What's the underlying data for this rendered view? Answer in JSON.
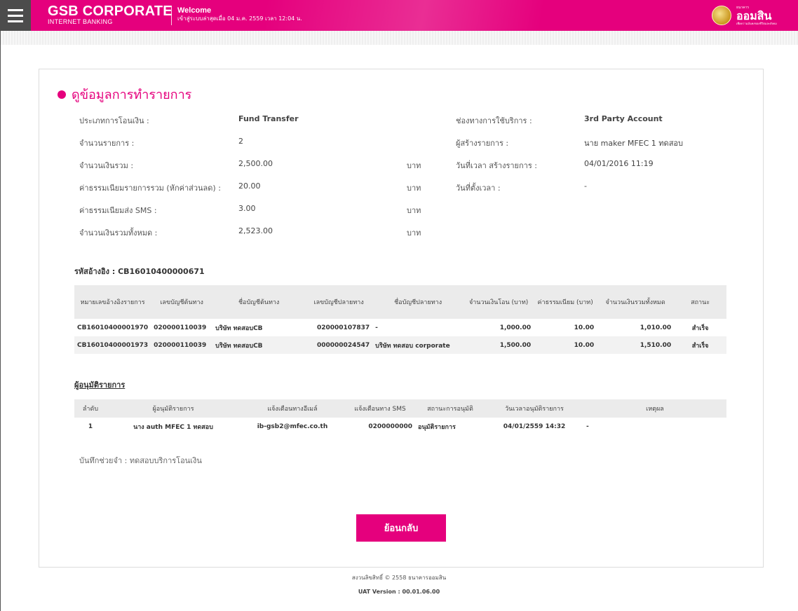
{
  "header": {
    "brand_title": "GSB CORPORATE",
    "brand_sub": "INTERNET BANKING",
    "welcome_title": "Welcome",
    "last_login": "เข้าสู่ระบบล่าสุดเมื่อ 04 ม.ค. 2559 เวลา 12:04 น.",
    "logo_small": "ธนาคาร",
    "logo_text": "ออมสิน",
    "logo_tag": "เพื่อความมั่นคงของชีวิตและสังคม",
    "menu_icon": "hamburger-menu-icon",
    "accent_color": "#e5007d"
  },
  "page": {
    "title": "ดูข้อมูลการทำรายการ"
  },
  "summary_left": [
    {
      "label": "ประเภทการโอนเงิน :",
      "value": "Fund Transfer",
      "unit": ""
    },
    {
      "label": "จำนวนรายการ :",
      "value": "2",
      "unit": ""
    },
    {
      "label": "จำนวนเงินรวม :",
      "value": "2,500.00",
      "unit": "บาท"
    },
    {
      "label": "ค่าธรรมเนียมรายการรวม (หักค่าส่วนลด) :",
      "value": "20.00",
      "unit": "บาท"
    },
    {
      "label": "ค่าธรรมเนียมส่ง SMS :",
      "value": "3.00",
      "unit": "บาท"
    },
    {
      "label": "จำนวนเงินรวมทั้งหมด :",
      "value": "2,523.00",
      "unit": "บาท"
    }
  ],
  "summary_right": [
    {
      "label": "ช่องทางการใช้บริการ :",
      "value": "3rd Party Account"
    },
    {
      "label": "ผู้สร้างรายการ :",
      "value": "นาย maker MFEC 1 ทดสอบ"
    },
    {
      "label": "วันที่เวลา สร้างรายการ :",
      "value": "04/01/2016 11:19"
    },
    {
      "label": "วันที่ตั้งเวลา :",
      "value": "-"
    }
  ],
  "reference": "รหัสอ้างอิง : CB16010400000671",
  "transactions": {
    "headers": [
      "หมายเลขอ้างอิงรายการ",
      "เลขบัญชีต้นทาง",
      "ชื่อบัญชีต้นทาง",
      "เลขบัญชีปลายทาง",
      "ชื่อบัญชีปลายทาง",
      "จำนวนเงินโอน (บาท)",
      "ค่าธรรมเนียม (บาท)",
      "จำนวนเงินรวมทั้งหมด",
      "สถานะ"
    ],
    "rows": [
      [
        "CB16010400001970",
        "020000110039",
        "บริษัท ทดสอบCB",
        "020000107837",
        "-",
        "1,000.00",
        "10.00",
        "1,010.00",
        "สำเร็จ"
      ],
      [
        "CB16010400001973",
        "020000110039",
        "บริษัท ทดสอบCB",
        "000000024547",
        "บริษัท ทดสอบ corporate",
        "1,500.00",
        "10.00",
        "1,510.00",
        "สำเร็จ"
      ]
    ]
  },
  "approvers": {
    "title": "ผู้อนุมัติรายการ",
    "headers": [
      "ลำดับ",
      "ผู้อนุมัติรายการ",
      "แจ้งเตือนทางอีเมล์",
      "แจ้งเตือนทาง SMS",
      "สถานะการอนุมัติ",
      "วันเวลาอนุมัติรายการ",
      "เหตุผล"
    ],
    "rows": [
      [
        "1",
        "นาง auth MFEC 1 ทดสอบ",
        "ib-gsb2@mfec.co.th",
        "0200000000",
        "อนุมัติรายการ",
        "04/01/2559 14:32",
        "-"
      ]
    ]
  },
  "memo": "บันทึกช่วยจำ : ทดสอบบริการโอนเงิน",
  "back_button": "ย้อนกลับ",
  "footer": {
    "copyright": "สงวนลิขสิทธิ์ © 2558 ธนาคารออมสิน",
    "version": "UAT Version : 00.01.06.00"
  }
}
